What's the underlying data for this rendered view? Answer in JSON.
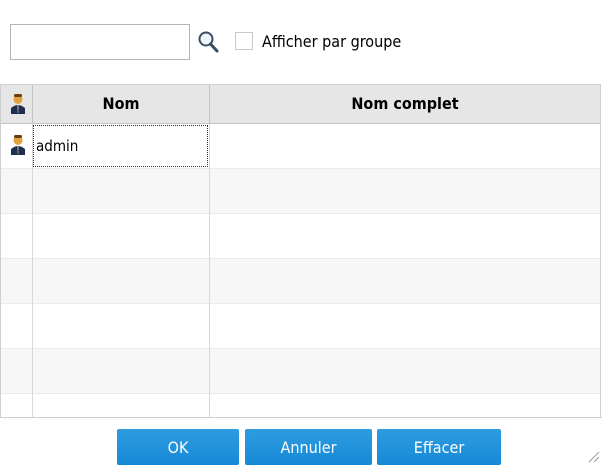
{
  "search": {
    "value": "",
    "placeholder": ""
  },
  "group_toggle": {
    "label": "Afficher par groupe",
    "checked": false
  },
  "table": {
    "columns": [
      "Nom",
      "Nom complet"
    ],
    "rows": [
      {
        "name": "admin",
        "full_name": ""
      }
    ]
  },
  "buttons": {
    "ok": "OK",
    "cancel": "Annuler",
    "clear": "Effacer"
  },
  "colors": {
    "button": "#1a8cd8",
    "header": "#e6e6e6"
  }
}
